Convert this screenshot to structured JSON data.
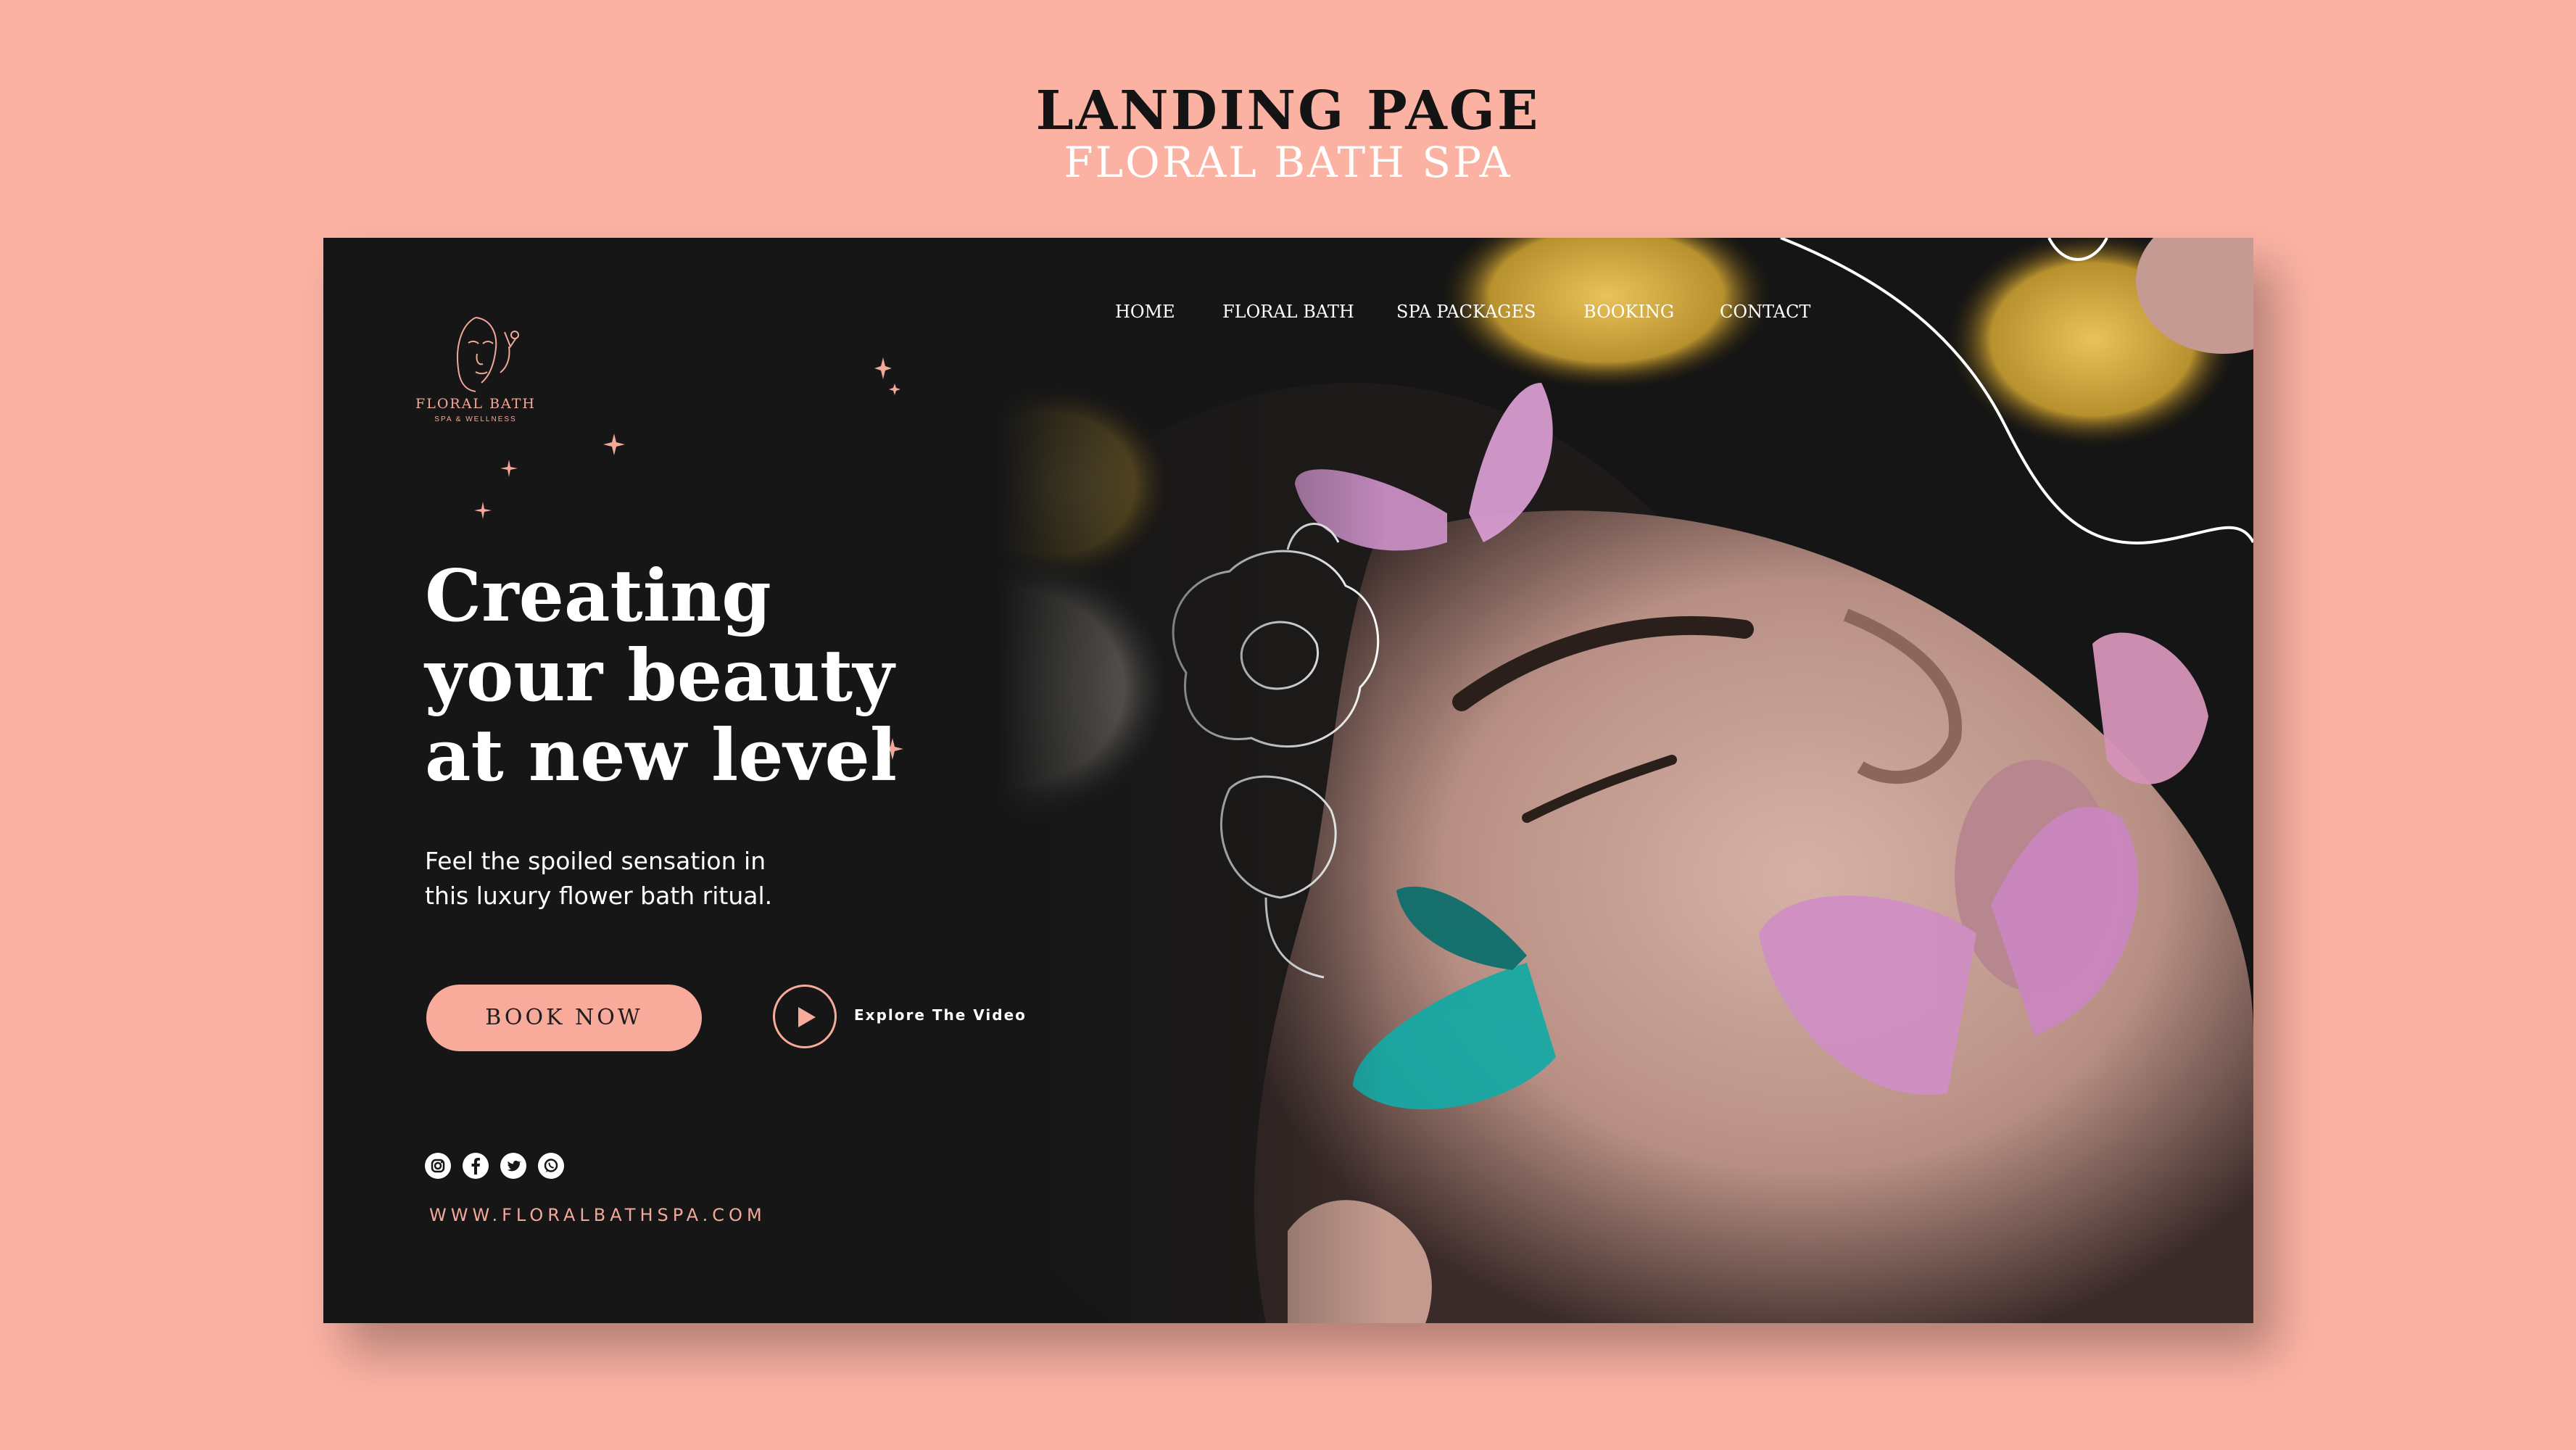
{
  "page": {
    "title": "LANDING PAGE",
    "subtitle": "FLORAL BATH SPA"
  },
  "brand": {
    "name": "FLORAL BATH",
    "tagline": "SPA & WELLNESS"
  },
  "nav": {
    "items": [
      {
        "label": "HOME"
      },
      {
        "label": "FLORAL BATH"
      },
      {
        "label": "SPA PACKAGES"
      },
      {
        "label": "BOOKING"
      },
      {
        "label": "CONTACT"
      }
    ]
  },
  "hero": {
    "headline": "Creating\nyour beauty\nat new level",
    "subtext": "Feel the spoiled sensation in\nthis luxury flower bath ritual.",
    "book_label": "BOOK NOW",
    "video_label": "Explore The Video"
  },
  "socials": [
    {
      "icon": "instagram-icon"
    },
    {
      "icon": "facebook-icon"
    },
    {
      "icon": "twitter-icon"
    },
    {
      "icon": "whatsapp-icon"
    }
  ],
  "footer": {
    "website": "WWW.FLORALBATHSPA.COM"
  },
  "colors": {
    "background": "#fbb2a3",
    "card": "#161616",
    "accent": "#f9ab9b",
    "text_dark": "#141414",
    "text_light": "#ffffff"
  }
}
